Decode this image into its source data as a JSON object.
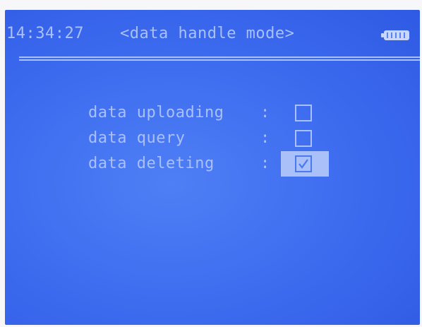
{
  "header": {
    "time": "14:34:27",
    "title": "<data handle mode>",
    "battery_icon": "battery-full-icon"
  },
  "menu": {
    "items": [
      {
        "label": "data uploading",
        "separator": ":",
        "checked": false,
        "selected": false
      },
      {
        "label": "data query",
        "separator": ":",
        "checked": false,
        "selected": false
      },
      {
        "label": "data deleting",
        "separator": ":",
        "checked": true,
        "selected": true
      }
    ]
  },
  "colors": {
    "screen_bg": "#3f6ef0",
    "text": "#a9c0f8",
    "highlight": "#a9c0f8"
  }
}
